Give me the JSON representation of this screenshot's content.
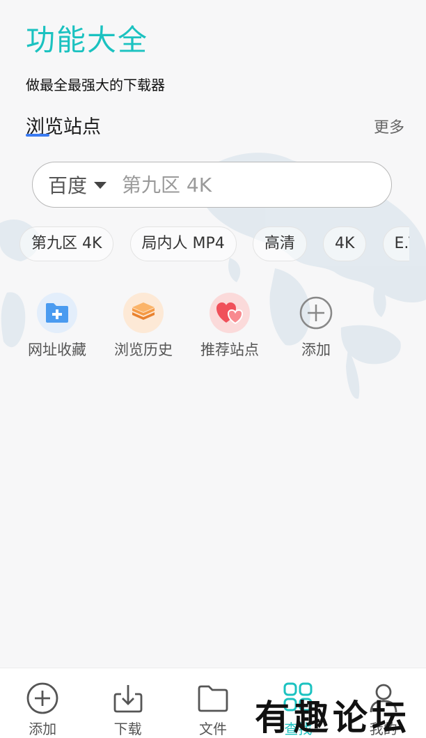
{
  "header": {
    "title": "功能大全",
    "subtitle": "做最全最强大的下载器"
  },
  "section": {
    "title": "浏览站点",
    "more_label": "更多"
  },
  "search": {
    "engine": "百度",
    "placeholder": "第九区 4K"
  },
  "chips": [
    "第九区 4K",
    "局内人 MP4",
    "高清",
    "4K",
    "E.T"
  ],
  "shortcuts": [
    {
      "label": "网址收藏",
      "icon": "bookmark-folder-icon"
    },
    {
      "label": "浏览历史",
      "icon": "layers-history-icon"
    },
    {
      "label": "推荐站点",
      "icon": "hearts-icon"
    },
    {
      "label": "添加",
      "icon": "plus-circle-icon"
    }
  ],
  "tabbar": [
    {
      "label": "添加",
      "icon": "plus-circle-icon"
    },
    {
      "label": "下载",
      "icon": "download-icon"
    },
    {
      "label": "文件",
      "icon": "folder-icon"
    },
    {
      "label": "查找",
      "icon": "grid-icon",
      "active": true
    },
    {
      "label": "我的",
      "icon": "user-icon"
    }
  ],
  "watermark": "有趣论坛",
  "colors": {
    "accent": "#1bc2c0",
    "underline": "#3a7bf2",
    "background": "#f7f7f8"
  }
}
